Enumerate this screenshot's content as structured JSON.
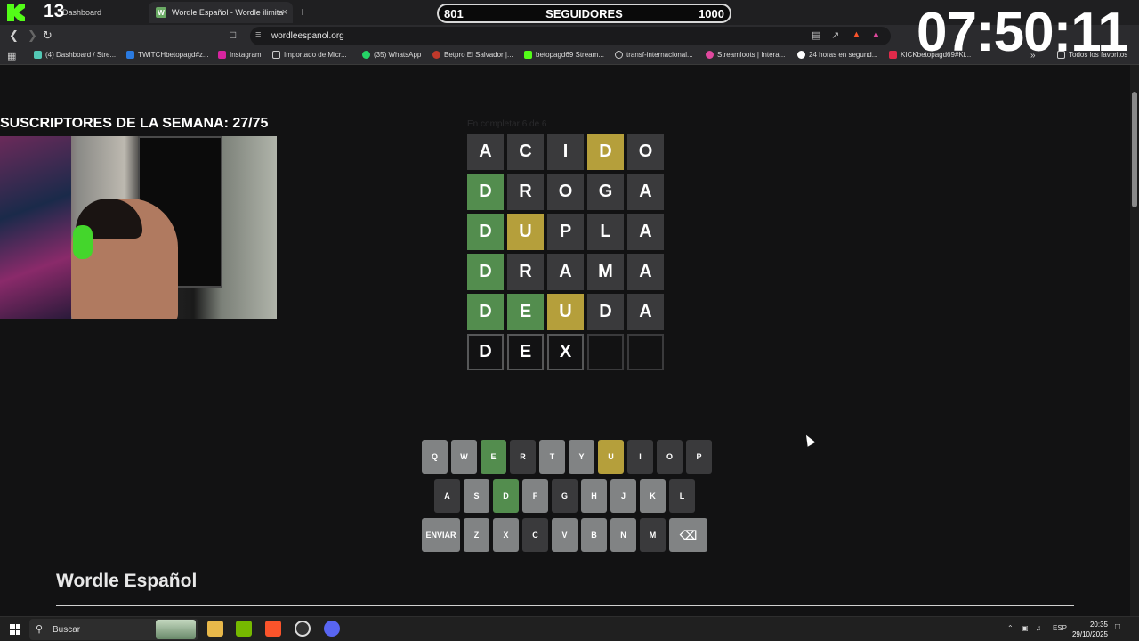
{
  "browser": {
    "tabs": [
      {
        "title": "Dashboard",
        "active": false
      },
      {
        "title": "Wordle Español - Wordle ilimita",
        "active": true
      }
    ],
    "new_tab_glyph": "+",
    "close_glyph": "×",
    "url": "wordleespanol.org",
    "bookmarks": [
      "(4) Dashboard / Stre...",
      "TWITCHbetopagd#z...",
      "Instagram",
      "Importado de Micr...",
      "(35) WhatsApp",
      "Betpro El Salvador |...",
      "betopagd69 Stream...",
      "transf-internacional...",
      "Streamloots | Intera...",
      "24 horas en segund...",
      "KICKbetopagd69#Ki..."
    ],
    "bookmarks_overflow": "»",
    "all_bookmarks": "Todos los favoritos"
  },
  "stream_overlay": {
    "kick_count": "13",
    "followers": {
      "current": "801",
      "label": "SEGUIDORES",
      "goal": "1000"
    },
    "clock": "07:50:11",
    "subs_label": "SUSCRIPTORES DE LA SEMANA: 27/75"
  },
  "game": {
    "faded_label": "En completar 6 de 6",
    "rows": [
      [
        {
          "l": "A",
          "s": "absent"
        },
        {
          "l": "C",
          "s": "absent"
        },
        {
          "l": "I",
          "s": "absent"
        },
        {
          "l": "D",
          "s": "present"
        },
        {
          "l": "O",
          "s": "absent"
        }
      ],
      [
        {
          "l": "D",
          "s": "correct"
        },
        {
          "l": "R",
          "s": "absent"
        },
        {
          "l": "O",
          "s": "absent"
        },
        {
          "l": "G",
          "s": "absent"
        },
        {
          "l": "A",
          "s": "absent"
        }
      ],
      [
        {
          "l": "D",
          "s": "correct"
        },
        {
          "l": "U",
          "s": "present"
        },
        {
          "l": "P",
          "s": "absent"
        },
        {
          "l": "L",
          "s": "absent"
        },
        {
          "l": "A",
          "s": "absent"
        }
      ],
      [
        {
          "l": "D",
          "s": "correct"
        },
        {
          "l": "R",
          "s": "absent"
        },
        {
          "l": "A",
          "s": "absent"
        },
        {
          "l": "M",
          "s": "absent"
        },
        {
          "l": "A",
          "s": "absent"
        }
      ],
      [
        {
          "l": "D",
          "s": "correct"
        },
        {
          "l": "E",
          "s": "correct"
        },
        {
          "l": "U",
          "s": "present"
        },
        {
          "l": "D",
          "s": "absent"
        },
        {
          "l": "A",
          "s": "absent"
        }
      ],
      [
        {
          "l": "D",
          "s": "typing"
        },
        {
          "l": "E",
          "s": "typing"
        },
        {
          "l": "X",
          "s": "typing"
        },
        {
          "l": "",
          "s": "empty"
        },
        {
          "l": "",
          "s": "empty"
        }
      ]
    ],
    "keyboard": [
      [
        {
          "k": "Q",
          "s": "unused"
        },
        {
          "k": "W",
          "s": "unused"
        },
        {
          "k": "E",
          "s": "correct"
        },
        {
          "k": "R",
          "s": "absent"
        },
        {
          "k": "T",
          "s": "unused"
        },
        {
          "k": "Y",
          "s": "unused"
        },
        {
          "k": "U",
          "s": "present"
        },
        {
          "k": "I",
          "s": "absent"
        },
        {
          "k": "O",
          "s": "absent"
        },
        {
          "k": "P",
          "s": "absent"
        }
      ],
      [
        {
          "k": "A",
          "s": "absent"
        },
        {
          "k": "S",
          "s": "unused"
        },
        {
          "k": "D",
          "s": "correct"
        },
        {
          "k": "F",
          "s": "unused"
        },
        {
          "k": "G",
          "s": "absent"
        },
        {
          "k": "H",
          "s": "unused"
        },
        {
          "k": "J",
          "s": "unused"
        },
        {
          "k": "K",
          "s": "unused"
        },
        {
          "k": "L",
          "s": "absent"
        }
      ],
      [
        {
          "k": "ENVIAR",
          "s": "unused",
          "wide": true
        },
        {
          "k": "Z",
          "s": "unused"
        },
        {
          "k": "X",
          "s": "unused"
        },
        {
          "k": "C",
          "s": "absent"
        },
        {
          "k": "V",
          "s": "unused"
        },
        {
          "k": "B",
          "s": "unused"
        },
        {
          "k": "N",
          "s": "unused"
        },
        {
          "k": "M",
          "s": "absent"
        },
        {
          "k": "⌫",
          "s": "unused",
          "wide": true
        }
      ]
    ]
  },
  "page": {
    "heading": "Wordle Español"
  },
  "taskbar": {
    "search_placeholder": "Buscar",
    "language": "ESP",
    "time": "20:35",
    "date": "29/10/2025"
  },
  "colors": {
    "correct": "#538d4e",
    "present": "#b59f3b",
    "absent": "#3a3a3c",
    "unused": "#818384",
    "background": "#121213"
  }
}
